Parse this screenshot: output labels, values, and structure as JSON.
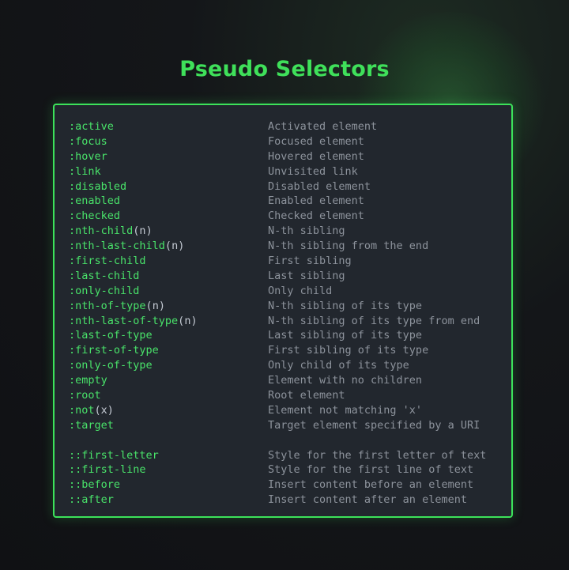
{
  "title": "Pseudo Selectors",
  "colors": {
    "accent": "#3ce25a",
    "selector": "#49e36a",
    "description": "#8d939c",
    "panel": "#22272e",
    "background": "#121316"
  },
  "pseudo_classes": [
    {
      "selector": ":active",
      "description": "Activated element"
    },
    {
      "selector": ":focus",
      "description": "Focused element"
    },
    {
      "selector": ":hover",
      "description": "Hovered element"
    },
    {
      "selector": ":link",
      "description": "Unvisited link"
    },
    {
      "selector": ":disabled",
      "description": "Disabled element"
    },
    {
      "selector": ":enabled",
      "description": "Enabled element"
    },
    {
      "selector": ":checked",
      "description": "Checked element"
    },
    {
      "selector": ":nth-child",
      "arg": "n",
      "description": "N-th sibling"
    },
    {
      "selector": ":nth-last-child",
      "arg": "n",
      "description": "N-th sibling from the end"
    },
    {
      "selector": ":first-child",
      "description": "First sibling"
    },
    {
      "selector": ":last-child",
      "description": "Last sibling"
    },
    {
      "selector": ":only-child",
      "description": "Only child"
    },
    {
      "selector": ":nth-of-type",
      "arg": "n",
      "description": "N-th sibling of its type"
    },
    {
      "selector": ":nth-last-of-type",
      "arg": "n",
      "description": "N-th sibling of its type from end"
    },
    {
      "selector": ":last-of-type",
      "description": "Last sibling of its type"
    },
    {
      "selector": ":first-of-type",
      "description": "First sibling of its type"
    },
    {
      "selector": ":only-of-type",
      "description": "Only child of its type"
    },
    {
      "selector": ":empty",
      "description": "Element with no children"
    },
    {
      "selector": ":root",
      "description": "Root element"
    },
    {
      "selector": ":not",
      "arg": "x",
      "description": "Element not matching 'x'"
    },
    {
      "selector": ":target",
      "description": "Target element specified by a URI"
    }
  ],
  "pseudo_elements": [
    {
      "selector": "::first-letter",
      "description": "Style for the first letter of text"
    },
    {
      "selector": "::first-line",
      "description": "Style for the first line of text"
    },
    {
      "selector": "::before",
      "description": "Insert content before an element"
    },
    {
      "selector": "::after",
      "description": "Insert content after an element"
    }
  ]
}
